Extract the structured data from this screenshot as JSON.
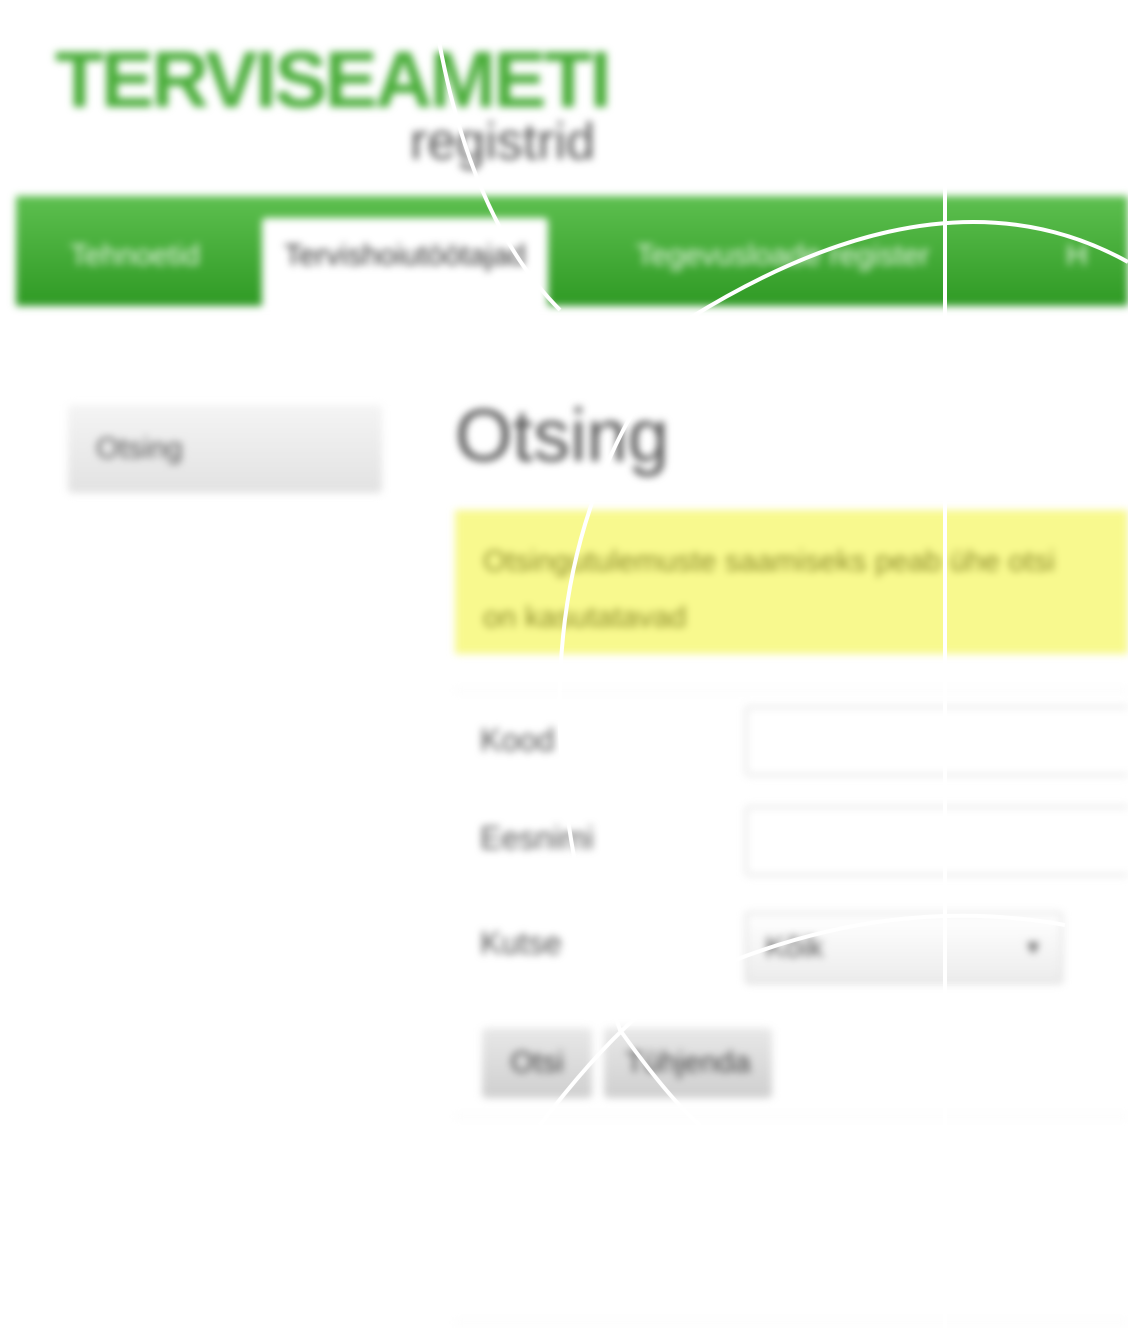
{
  "header": {
    "logo_title": "TERVISEAMETI",
    "logo_subtitle": "registrid"
  },
  "nav": {
    "tabs": [
      {
        "label": "Tehnoetid",
        "active": false
      },
      {
        "label": "Tervishoiutöötajad",
        "active": true
      },
      {
        "label": "Tegevusloade register",
        "active": false
      },
      {
        "label": "H",
        "active": false
      }
    ]
  },
  "sidebar": {
    "items": [
      {
        "label": "Otsing"
      }
    ]
  },
  "main": {
    "title": "Otsing",
    "notice_line1": "Otsingutulemuste saamiseks peab ühe otsi",
    "notice_line2": "on kasutatavad",
    "fields": {
      "kood_label": "Kood",
      "eesnimi_label": "Eesnimi",
      "kutse_label": "Kutse",
      "kutse_value": "Kõik"
    },
    "buttons": {
      "search_label": "Otsi",
      "reset_label": "Tühjenda"
    }
  },
  "colors": {
    "brand_green": "#4aad3a",
    "notice_yellow": "#f8f98e"
  }
}
